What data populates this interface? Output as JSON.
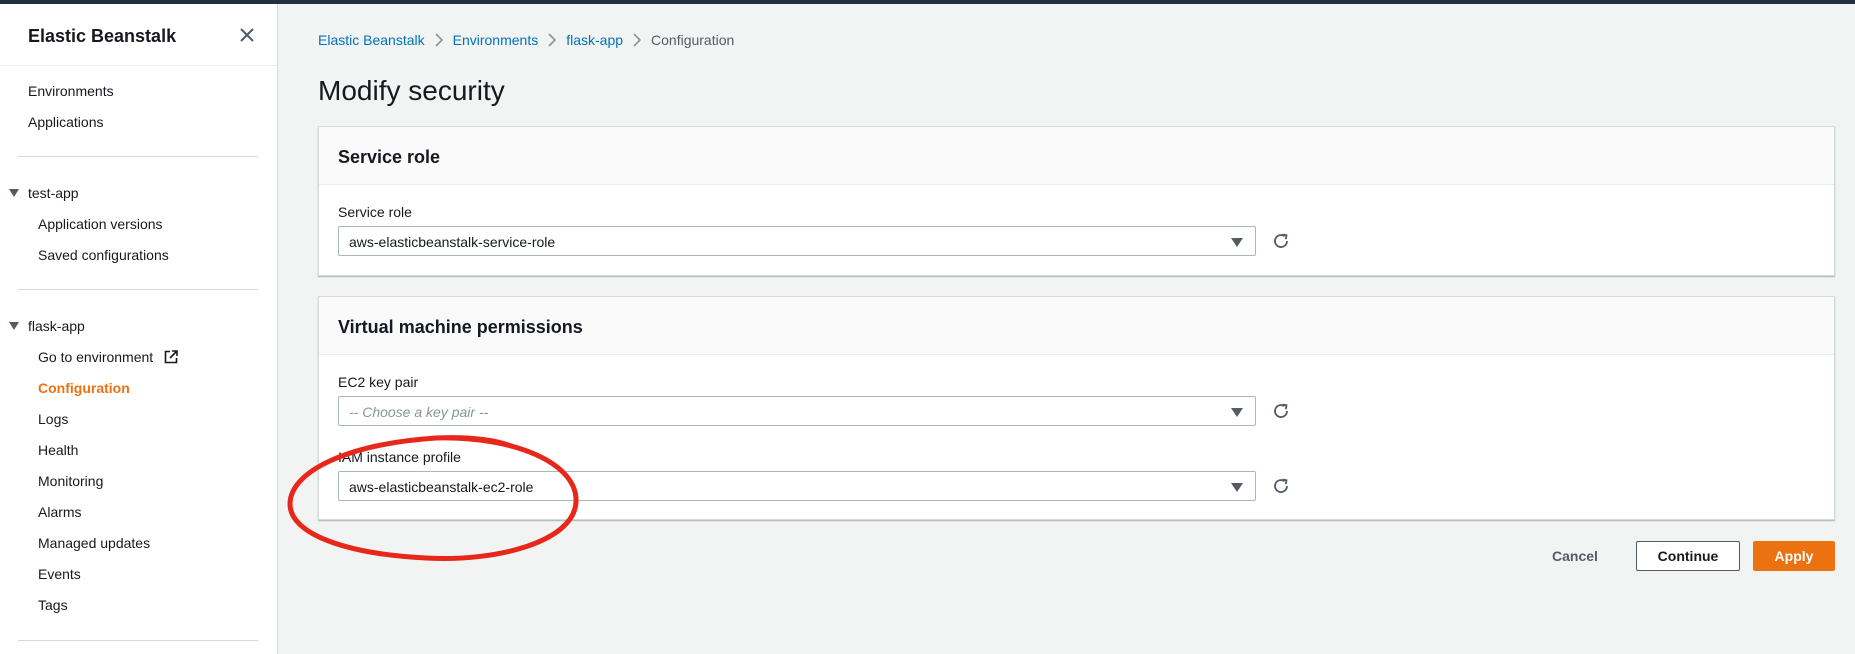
{
  "sidebar": {
    "title": "Elastic Beanstalk",
    "top_links": [
      "Environments",
      "Applications"
    ],
    "test_app": {
      "label": "test-app",
      "items": [
        "Application versions",
        "Saved configurations"
      ]
    },
    "flask_app": {
      "label": "flask-app",
      "items": [
        "Go to environment",
        "Configuration",
        "Logs",
        "Health",
        "Monitoring",
        "Alarms",
        "Managed updates",
        "Events",
        "Tags"
      ],
      "active_item": "Configuration"
    }
  },
  "breadcrumb": {
    "links": [
      "Elastic Beanstalk",
      "Environments",
      "flask-app"
    ],
    "current": "Configuration"
  },
  "page": {
    "title": "Modify security"
  },
  "service_role_panel": {
    "title": "Service role",
    "field_label": "Service role",
    "value": "aws-elasticbeanstalk-service-role"
  },
  "vm_panel": {
    "title": "Virtual machine permissions",
    "ec2_label": "EC2 key pair",
    "ec2_placeholder": "-- Choose a key pair --",
    "iam_label": "IAM instance profile",
    "iam_value": "aws-elasticbeanstalk-ec2-role"
  },
  "actions": {
    "cancel": "Cancel",
    "continue": "Continue",
    "apply": "Apply"
  },
  "icons": {
    "close": "close-icon",
    "caret": "caret-down-icon",
    "external": "external-link-icon",
    "refresh": "refresh-icon",
    "chevron": "chevron-right-icon"
  },
  "colors": {
    "accent": "#ec7211",
    "link": "#0073bb",
    "annotation": "#e8271b",
    "topbar": "#232f3e"
  }
}
